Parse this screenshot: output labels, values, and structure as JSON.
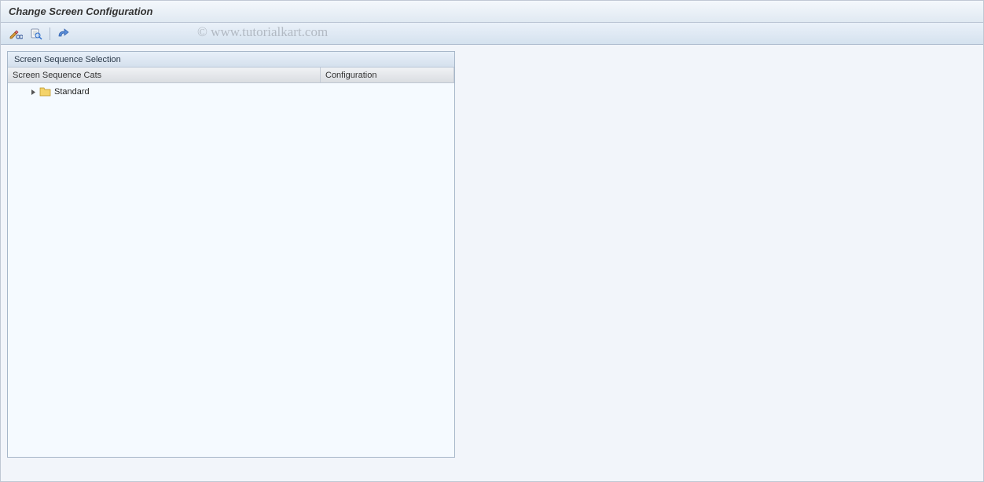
{
  "header": {
    "title": "Change Screen Configuration"
  },
  "toolbar": {
    "items": [
      {
        "name": "change-display",
        "icon": "pencil-glasses"
      },
      {
        "name": "find",
        "icon": "search"
      },
      {
        "sep": true
      },
      {
        "name": "img-activity",
        "icon": "curved-arrow"
      }
    ]
  },
  "watermark": "© www.tutorialkart.com",
  "panel": {
    "title": "Screen Sequence Selection",
    "columns": {
      "col1": "Screen Sequence Cats",
      "col2": "Configuration"
    },
    "rows": [
      {
        "expanded": false,
        "icon": "folder",
        "label": "Standard",
        "config": ""
      }
    ]
  }
}
